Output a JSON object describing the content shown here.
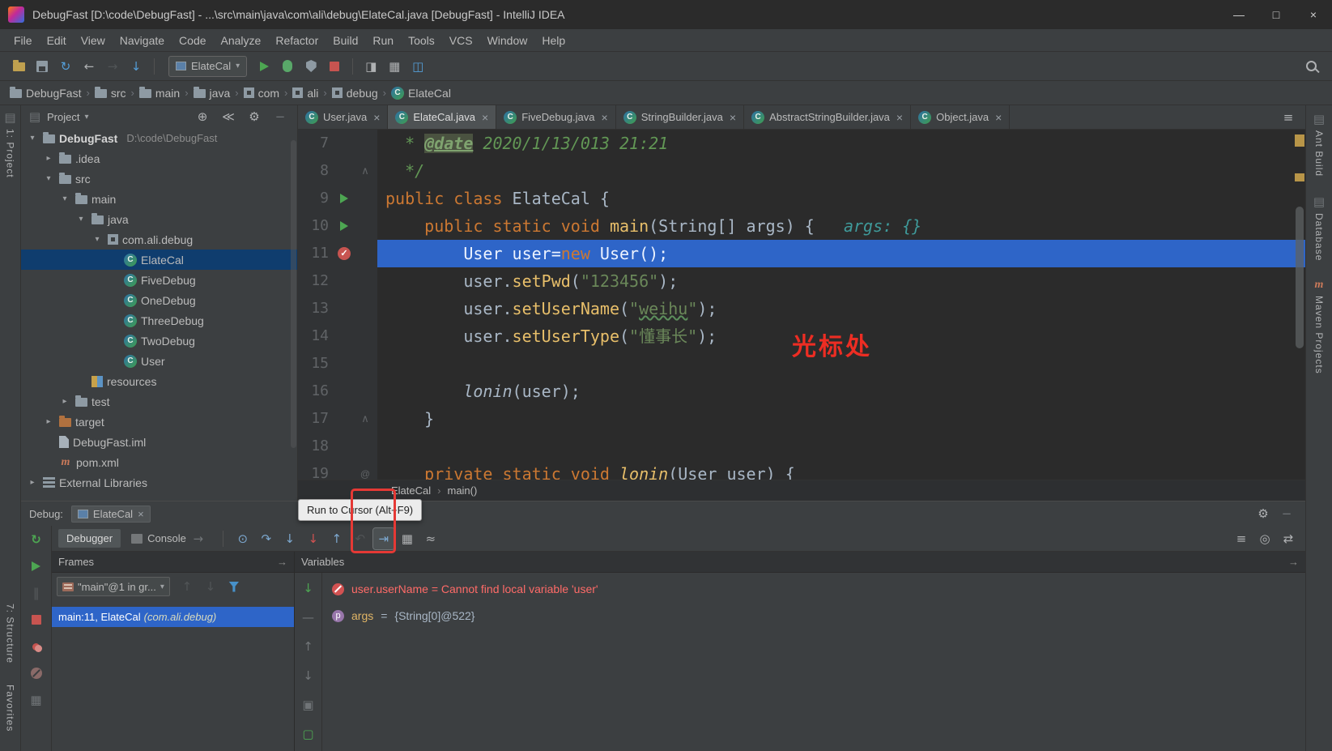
{
  "titlebar": {
    "title": "DebugFast [D:\\code\\DebugFast] - ...\\src\\main\\java\\com\\ali\\debug\\ElateCal.java [DebugFast] - IntelliJ IDEA",
    "controls": {
      "minimize": "—",
      "maximize": "□",
      "close": "×"
    }
  },
  "menubar": [
    "File",
    "Edit",
    "View",
    "Navigate",
    "Code",
    "Analyze",
    "Refactor",
    "Build",
    "Run",
    "Tools",
    "VCS",
    "Window",
    "Help"
  ],
  "toolbar": {
    "left_icons": [
      {
        "name": "open-file-icon",
        "glyph": "folder-open"
      },
      {
        "name": "save-all-icon",
        "glyph": "save"
      },
      {
        "name": "synchronize-icon",
        "glyph": "sync"
      },
      {
        "name": "back-icon",
        "glyph": "back"
      },
      {
        "name": "forward-icon",
        "glyph": "forward",
        "disabled": true
      },
      {
        "name": "update-project-icon",
        "glyph": "update"
      }
    ],
    "run_config": {
      "label": "ElateCal"
    },
    "run_icons": [
      {
        "name": "run-icon",
        "glyph": "run"
      },
      {
        "name": "debug-icon",
        "glyph": "bug"
      },
      {
        "name": "coverage-icon",
        "glyph": "coverage"
      },
      {
        "name": "stop-icon",
        "glyph": "stop"
      }
    ],
    "plugin_icons": [
      {
        "name": "inspections-plugin-icon",
        "glyph": "plug1"
      },
      {
        "name": "code-rules-plugin-icon",
        "glyph": "plug2"
      },
      {
        "name": "window-switch-plugin-icon",
        "glyph": "plug3"
      }
    ]
  },
  "navbar": {
    "crumbs": [
      {
        "label": "DebugFast",
        "icon": "folder"
      },
      {
        "label": "src",
        "icon": "folder"
      },
      {
        "label": "main",
        "icon": "folder"
      },
      {
        "label": "java",
        "icon": "folder"
      },
      {
        "label": "com",
        "icon": "package"
      },
      {
        "label": "ali",
        "icon": "package"
      },
      {
        "label": "debug",
        "icon": "package"
      },
      {
        "label": "ElateCal",
        "icon": "class"
      }
    ]
  },
  "stripes": {
    "left_top": [
      {
        "label": "1: Project",
        "icon": "stripeicon"
      }
    ],
    "left_bottom": [
      {
        "label": "7: Structure"
      },
      {
        "label": "Favorites"
      }
    ],
    "right": [
      {
        "label": "Ant Build",
        "icon": "stripeicon"
      },
      {
        "label": "Database",
        "icon": "stripeicon"
      },
      {
        "label": "Maven Projects",
        "icon": "mavenm"
      }
    ]
  },
  "project": {
    "title": "Project",
    "header_icons": [
      {
        "name": "locate-file-icon",
        "glyph": "locate"
      },
      {
        "name": "collapse-all-icon",
        "glyph": "collapse"
      },
      {
        "name": "project-settings-icon",
        "glyph": "gear"
      },
      {
        "name": "hide-project-panel-icon",
        "glyph": "hide"
      }
    ],
    "tree": [
      {
        "depth": 0,
        "arrow": "down",
        "icon": "project",
        "label": "DebugFast",
        "extra": "D:\\code\\DebugFast",
        "bold": true
      },
      {
        "depth": 1,
        "arrow": "right",
        "icon": "folder",
        "label": ".idea"
      },
      {
        "depth": 1,
        "arrow": "down",
        "icon": "folder",
        "label": "src"
      },
      {
        "depth": 2,
        "arrow": "down",
        "icon": "folder",
        "label": "main"
      },
      {
        "depth": 3,
        "arrow": "down",
        "icon": "folder",
        "label": "java"
      },
      {
        "depth": 4,
        "arrow": "down",
        "icon": "package",
        "label": "com.ali.debug"
      },
      {
        "depth": 5,
        "arrow": "none",
        "icon": "class",
        "label": "ElateCal",
        "selected": true
      },
      {
        "depth": 5,
        "arrow": "none",
        "icon": "class",
        "label": "FiveDebug"
      },
      {
        "depth": 5,
        "arrow": "none",
        "icon": "class",
        "label": "OneDebug"
      },
      {
        "depth": 5,
        "arrow": "none",
        "icon": "class",
        "label": "ThreeDebug"
      },
      {
        "depth": 5,
        "arrow": "none",
        "icon": "class",
        "label": "TwoDebug"
      },
      {
        "depth": 5,
        "arrow": "none",
        "icon": "class",
        "label": "User"
      },
      {
        "depth": 3,
        "arrow": "none",
        "icon": "resources",
        "label": "resources"
      },
      {
        "depth": 2,
        "arrow": "right",
        "icon": "folder",
        "label": "test"
      },
      {
        "depth": 1,
        "arrow": "right",
        "icon": "folder-excluded",
        "label": "target"
      },
      {
        "depth": 1,
        "arrow": "none",
        "icon": "file",
        "label": "DebugFast.iml"
      },
      {
        "depth": 1,
        "arrow": "none",
        "icon": "maven",
        "label": "pom.xml"
      },
      {
        "depth": 0,
        "arrow": "right",
        "icon": "library",
        "label": "External Libraries"
      }
    ]
  },
  "editor": {
    "tabs": [
      {
        "label": "User.java"
      },
      {
        "label": "ElateCal.java",
        "active": true
      },
      {
        "label": "FiveDebug.java"
      },
      {
        "label": "StringBuilder.java"
      },
      {
        "label": "AbstractStringBuilder.java"
      },
      {
        "label": "Object.java"
      }
    ],
    "tabbar_icons": [
      {
        "name": "tabs-list-icon",
        "glyph": "stack"
      }
    ],
    "lines": [
      {
        "num": 7,
        "segs": [
          {
            "t": "  * ",
            "c": "doc"
          },
          {
            "t": "@date",
            "c": "doctag"
          },
          {
            "t": " 2020/1/13/013 21:21",
            "c": "doc"
          }
        ]
      },
      {
        "num": 8,
        "fold": "up",
        "segs": [
          {
            "t": "  */",
            "c": "doc"
          }
        ]
      },
      {
        "num": 9,
        "marker": "run",
        "segs": [
          {
            "t": "public class ",
            "c": "kw"
          },
          {
            "t": "ElateCal {",
            "c": "plain"
          }
        ]
      },
      {
        "num": 10,
        "marker": "run",
        "segs": [
          {
            "t": "    ",
            "c": "plain"
          },
          {
            "t": "public static void ",
            "c": "kw"
          },
          {
            "t": "main",
            "c": "method"
          },
          {
            "t": "(String[] args) {",
            "c": "plain"
          },
          {
            "t": "   args: {}",
            "c": "hint"
          }
        ]
      },
      {
        "num": 11,
        "marker": "breakpoint",
        "exec": true,
        "segs": [
          {
            "t": "        User user=",
            "c": "plain"
          },
          {
            "t": "new",
            "c": "kw"
          },
          {
            "t": " User();",
            "c": "plain"
          }
        ]
      },
      {
        "num": 12,
        "segs": [
          {
            "t": "        user.",
            "c": "plain"
          },
          {
            "t": "setPwd",
            "c": "method"
          },
          {
            "t": "(",
            "c": "plain"
          },
          {
            "t": "\"123456\"",
            "c": "str"
          },
          {
            "t": ");",
            "c": "plain"
          }
        ]
      },
      {
        "num": 13,
        "segs": [
          {
            "t": "        user.",
            "c": "plain"
          },
          {
            "t": "setUserName",
            "c": "method"
          },
          {
            "t": "(",
            "c": "plain"
          },
          {
            "t": "\"",
            "c": "str"
          },
          {
            "t": "weihu",
            "c": "str typo"
          },
          {
            "t": "\"",
            "c": "str"
          },
          {
            "t": ");",
            "c": "plain"
          }
        ]
      },
      {
        "num": 14,
        "segs": [
          {
            "t": "        user.",
            "c": "plain"
          },
          {
            "t": "setUserType",
            "c": "method"
          },
          {
            "t": "(",
            "c": "plain"
          },
          {
            "t": "\"懂事长\"",
            "c": "str"
          },
          {
            "t": ");",
            "c": "plain"
          }
        ]
      },
      {
        "num": 15,
        "segs": []
      },
      {
        "num": 16,
        "segs": [
          {
            "t": "        ",
            "c": "plain"
          },
          {
            "t": "lonin",
            "c": "plain italic"
          },
          {
            "t": "(user);",
            "c": "plain"
          }
        ]
      },
      {
        "num": 17,
        "fold": "up",
        "segs": [
          {
            "t": "    }",
            "c": "plain"
          }
        ]
      },
      {
        "num": 18,
        "segs": []
      },
      {
        "num": 19,
        "fold": "at",
        "segs": [
          {
            "t": "    ",
            "c": "plain"
          },
          {
            "t": "private static void ",
            "c": "kw"
          },
          {
            "t": "lonin",
            "c": "method italic"
          },
          {
            "t": "(User user) {",
            "c": "plain"
          }
        ]
      }
    ],
    "breadcrumb": {
      "class_name": "ElateCal",
      "member": "main()"
    }
  },
  "debug": {
    "label": "Debug:",
    "session": {
      "label": "ElateCal"
    },
    "header_icons": [
      {
        "name": "debug-settings-icon",
        "glyph": "gear"
      },
      {
        "name": "hide-debug-panel-icon",
        "glyph": "hide"
      }
    ],
    "tool_tabs": [
      {
        "label": "Debugger",
        "selected": true
      },
      {
        "label": "Console",
        "icon": "console",
        "pin": true
      }
    ],
    "steps": [
      {
        "name": "show-execution-point-icon",
        "glyph": "execpoint"
      },
      {
        "name": "step-over-icon",
        "glyph": "stepover"
      },
      {
        "name": "step-into-icon",
        "glyph": "stepinto"
      },
      {
        "name": "force-step-into-icon",
        "glyph": "forcestep"
      },
      {
        "name": "step-out-icon",
        "glyph": "stepout"
      },
      {
        "name": "drop-frame-icon",
        "glyph": "dropframe",
        "disabled": true
      },
      {
        "name": "run-to-cursor-icon",
        "glyph": "runcursor",
        "highlight": true
      },
      {
        "name": "evaluate-expression-icon",
        "glyph": "evaluate"
      },
      {
        "name": "view-threads-icon",
        "glyph": "trace"
      }
    ],
    "right_icons": [
      {
        "name": "restore-layout-icon",
        "glyph": "stack"
      },
      {
        "name": "thread-snapshot-icon",
        "glyph": "camera"
      },
      {
        "name": "switch-view-icon",
        "glyph": "swap"
      }
    ],
    "left_icons": [
      {
        "name": "rerun-debug-icon",
        "glyph": "rerun"
      },
      {
        "name": "resume-program-icon",
        "glyph": "resume"
      },
      {
        "name": "pause-program-icon",
        "glyph": "pause",
        "disabled": true
      },
      {
        "name": "stop-debug-icon",
        "glyph": "stopred"
      },
      {
        "name": "view-breakpoints-icon",
        "glyph": "bpview"
      },
      {
        "name": "mute-breakpoints-icon",
        "glyph": "bpmute"
      },
      {
        "name": "debug-layout-settings-icon",
        "glyph": "grid"
      }
    ],
    "frames": {
      "title": "Frames",
      "thread": "\"main\"@1 in gr...",
      "toolbar_icons": [
        {
          "name": "frame-up-icon",
          "glyph": "up",
          "disabled": true
        },
        {
          "name": "frame-down-icon",
          "glyph": "down",
          "disabled": true
        },
        {
          "name": "filter-frames-icon",
          "glyph": "filter"
        }
      ],
      "rows": [
        {
          "main": "main:11, ElateCal ",
          "pkg": "(com.ali.debug)",
          "selected": true
        }
      ]
    },
    "watch_icons": [
      {
        "name": "add-to-watches-icon",
        "glyph": "watchadd"
      },
      {
        "name": "remove-watch-icon",
        "glyph": "watchrem"
      },
      {
        "name": "move-watch-up-icon",
        "glyph": "up"
      },
      {
        "name": "move-watch-down-icon",
        "glyph": "down"
      },
      {
        "name": "duplicate-watch-icon",
        "glyph": "dup"
      },
      {
        "name": "show-watches-icon",
        "glyph": "showw"
      }
    ],
    "variables": {
      "title": "Variables",
      "rows": [
        {
          "icon": "error",
          "segs": [
            {
              "t": "user.userName = Cannot find local variable 'user'",
              "c": "err"
            }
          ]
        },
        {
          "icon": "param",
          "segs": [
            {
              "t": "args",
              "c": "vname"
            },
            {
              "t": " = ",
              "c": "vplain"
            },
            {
              "t": "{String[0]@522}",
              "c": "vval"
            }
          ]
        }
      ]
    }
  },
  "annotations": {
    "tooltip": "Run to Cursor (Alt+F9)",
    "cursor_note": "光标处"
  }
}
